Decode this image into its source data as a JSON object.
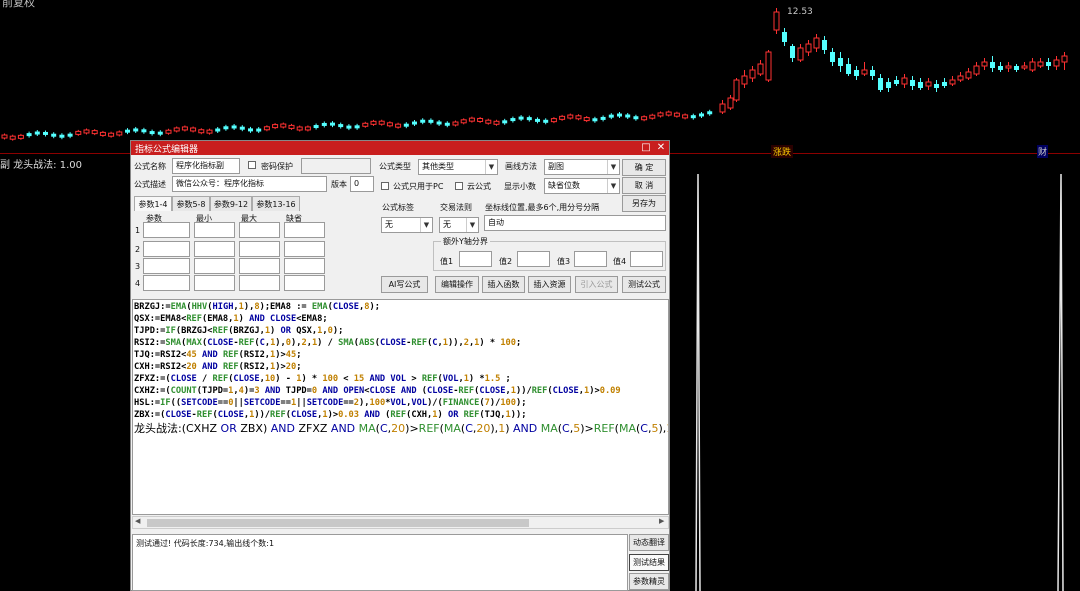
{
  "chart": {
    "top_label": "前复权",
    "high_price": "12.53",
    "zhangting_tag": "涨跌",
    "cai_tag": "财",
    "indicator_label": "副 龙头战法: 1.00"
  },
  "editor": {
    "title": "指标公式编辑器",
    "title_buttons": [
      "□",
      "✕"
    ],
    "name_label": "公式名称",
    "name_value": "程序化指标副",
    "password_label": "密码保护",
    "desc_label": "公式描述",
    "desc_value": "微信公众号：程序化指标",
    "version_label": "版本",
    "version_value": "0",
    "type_label": "公式类型",
    "type_value": "其他类型",
    "draw_label": "画线方法",
    "draw_value": "副图",
    "pc_only_label": "公式只用于PC",
    "cloud_label": "云公式",
    "decimals_label": "显示小数",
    "decimals_value": "缺省位数",
    "ok_button": "确  定",
    "cancel_button": "取  消",
    "saveas_button": "另存为",
    "tabs": [
      "参数1-4",
      "参数5-8",
      "参数9-12",
      "参数13-16"
    ],
    "param_headers": [
      "参数",
      "最小",
      "最大",
      "缺省"
    ],
    "param_rows": [
      "1",
      "2",
      "3",
      "4"
    ],
    "formula_tag_label": "公式标签",
    "formula_tag_value": "无",
    "trade_rule_label": "交易法则",
    "trade_rule_value": "无",
    "axis_label": "坐标线位置,最多6个,用分号分隔",
    "axis_value": "自动",
    "extra_y_label": "额外Y轴分界",
    "value_labels": [
      "值1",
      "值2",
      "值3",
      "值4"
    ],
    "buttons": [
      "AI写公式",
      "编辑操作",
      "插入函数",
      "插入资源",
      "引入公式",
      "测试公式"
    ],
    "status_text": "测试通过! 代码长度:734,输出线个数:1",
    "side_buttons": [
      "动态翻译",
      "测试结果",
      "参数精灵"
    ]
  }
}
